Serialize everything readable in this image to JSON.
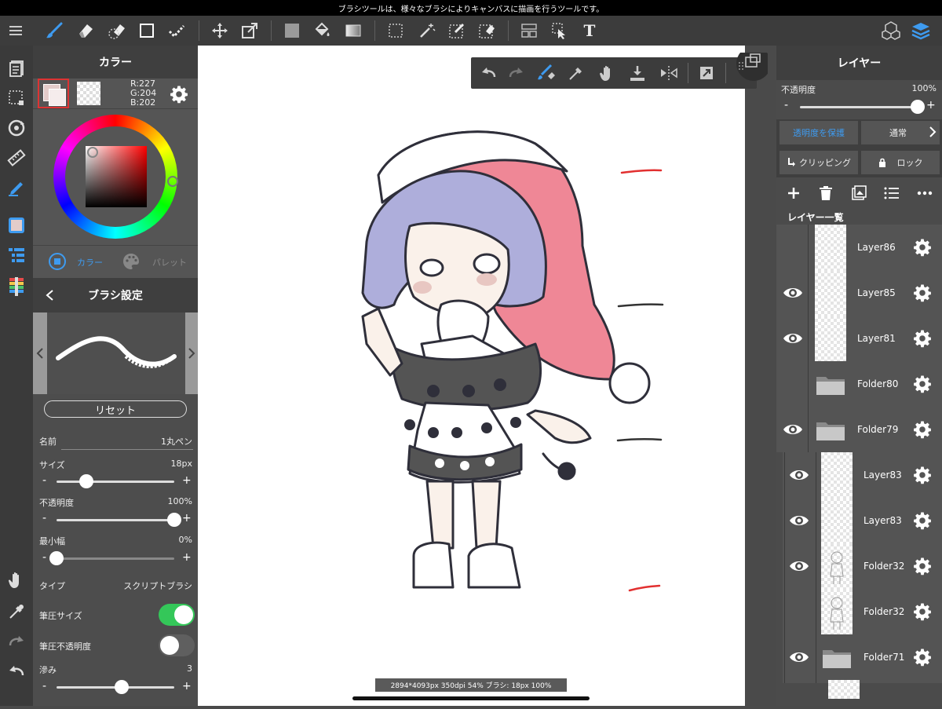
{
  "status_message": "ブラシツールは、様々なブラシによりキャンバスに描画を行うツールです。",
  "toolbar": {
    "left_tools": [
      "menu-icon",
      "brush-icon",
      "eraser-icon",
      "lasso-eraser-icon",
      "rectangle-icon",
      "check-icon"
    ],
    "mid_tools": [
      "move-icon",
      "transform-icon",
      "fill-color-icon",
      "bucket-icon",
      "gradient-icon"
    ],
    "select_tools": [
      "select-rect-icon",
      "magic-wand-icon",
      "select-pen-icon",
      "select-eraser-icon"
    ],
    "right_tools": [
      "layout-icon",
      "pointer-icon",
      "text-icon"
    ],
    "text_tool_label": "T"
  },
  "color_panel": {
    "title": "カラー",
    "rgb": {
      "r": "R:227",
      "g": "G:204",
      "b": "B:202"
    },
    "primary_color": "#e3ccca",
    "tabs": {
      "color": "カラー",
      "palette": "パレット"
    }
  },
  "brush_panel": {
    "title": "ブラシ設定",
    "reset_label": "リセット",
    "name": {
      "label": "名前",
      "value": "1丸ペン"
    },
    "size": {
      "label": "サイズ",
      "value": "18px",
      "level": 0.25
    },
    "opacity": {
      "label": "不透明度",
      "value": "100%",
      "level": 1.0
    },
    "min_width": {
      "label": "最小幅",
      "value": "0%",
      "level": 0.0
    },
    "type": {
      "label": "タイプ",
      "value": "スクリプトブラシ"
    },
    "pressure_size": {
      "label": "筆圧サイズ",
      "on": true
    },
    "pressure_opacity": {
      "label": "筆圧不透明度",
      "on": false
    },
    "blur": {
      "label": "滲み",
      "value": "3",
      "level": 0.55
    },
    "minus": "-",
    "plus": "+"
  },
  "layer_panel": {
    "title": "レイヤー",
    "opacity_label": "不透明度",
    "opacity_value": "100%",
    "opacity_level": 1.0,
    "protect_alpha": "透明度を保護",
    "blend_mode": "通常",
    "clipping": "クリッピング",
    "lock": "ロック",
    "list_title": "レイヤー一覧",
    "minus": "-",
    "plus": "+",
    "layers": [
      {
        "name": "Layer86",
        "visible": false,
        "type": "layer"
      },
      {
        "name": "Layer85",
        "visible": true,
        "type": "layer"
      },
      {
        "name": "Layer81",
        "visible": true,
        "type": "layer"
      },
      {
        "name": "Folder80",
        "visible": false,
        "type": "folder"
      },
      {
        "name": "Folder79",
        "visible": true,
        "type": "folder"
      },
      {
        "name": "Layer83",
        "visible": true,
        "type": "layer"
      },
      {
        "name": "Layer83",
        "visible": true,
        "type": "layer"
      },
      {
        "name": "Folder32",
        "visible": true,
        "type": "sketch"
      },
      {
        "name": "Folder32",
        "visible": false,
        "type": "sketch"
      },
      {
        "name": "Folder71",
        "visible": true,
        "type": "folder"
      }
    ]
  },
  "canvas_info": "2894*4093px 350dpi 54% ブラシ: 18px 100%",
  "colors": {
    "accent_blue": "#3e9bf0",
    "toggle_on": "#34c759",
    "hood_pink": "#ef8796",
    "hair_lavender": "#aeaedb"
  }
}
